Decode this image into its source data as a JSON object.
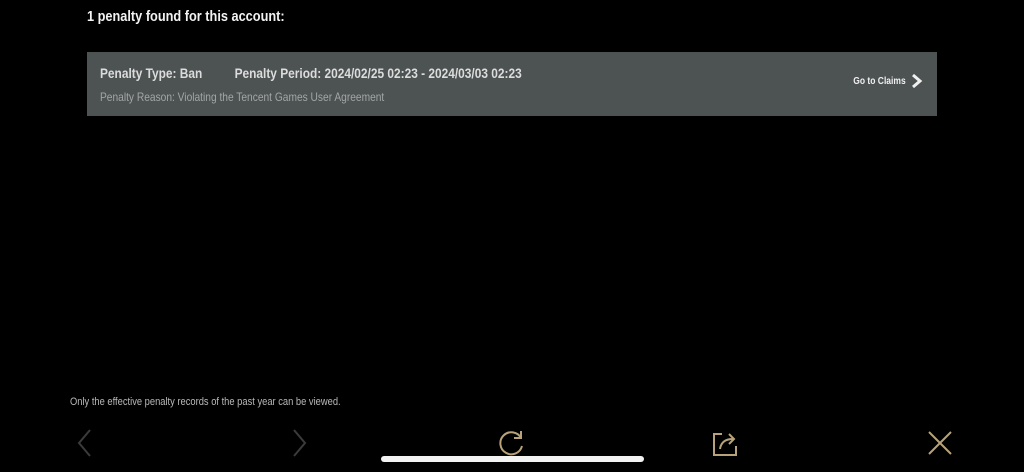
{
  "header": {
    "title": "1 penalty found for this account:"
  },
  "penalty": {
    "type_text": "Penalty Type: Ban",
    "period_text": "Penalty Period: 2024/02/25 02:23 - 2024/03/03 02:23",
    "reason_text": "Penalty Reason: Violating the Tencent Games User Agreement",
    "claims_label": "Go to Claims"
  },
  "footer": {
    "note": "Only the effective penalty records of the past year can be viewed."
  },
  "toolbar": {
    "icons": [
      "back-arrow-icon",
      "forward-arrow-icon",
      "refresh-icon",
      "share-icon",
      "close-icon"
    ],
    "icon_color": "#b7a27a",
    "disabled_color": "#3b3b3b"
  },
  "colors": {
    "background": "#000000",
    "card": "#4d5252"
  }
}
